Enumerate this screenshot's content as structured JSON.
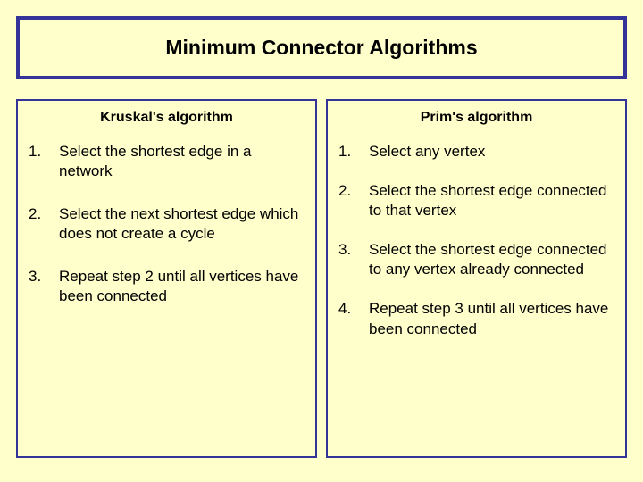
{
  "title": "Minimum Connector Algorithms",
  "left": {
    "heading": "Kruskal's algorithm",
    "steps": [
      "Select the shortest edge in a network",
      "Select the next shortest edge which does not create a cycle",
      "Repeat step 2 until all vertices have been connected"
    ]
  },
  "right": {
    "heading": "Prim's algorithm",
    "steps": [
      "Select any vertex",
      "Select the shortest edge connected to that vertex",
      "Select the shortest edge connected to any vertex already connected",
      "Repeat step 3 until all vertices have been connected"
    ]
  }
}
